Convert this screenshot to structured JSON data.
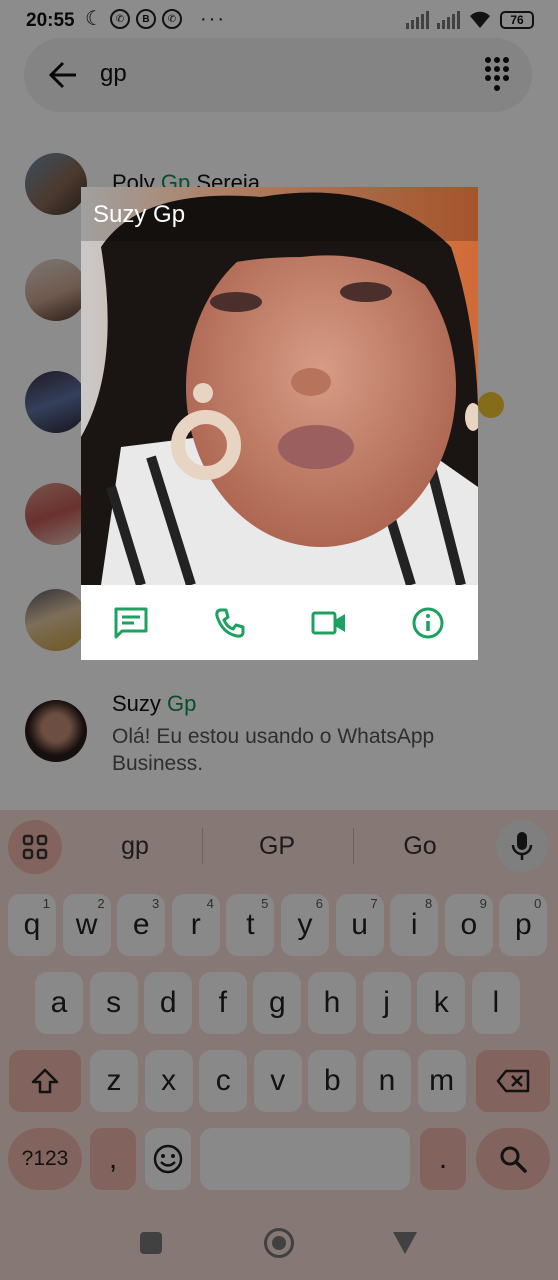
{
  "status_bar": {
    "time": "20:55",
    "notification_icons": [
      "moon-icon",
      "whatsapp-icon",
      "whatsapp-business-icon",
      "whatsapp-icon"
    ],
    "more": "···",
    "battery": "76"
  },
  "search": {
    "query": "gp"
  },
  "results": [
    {
      "name_prefix": "Poly ",
      "name_match": "Gp",
      "name_suffix": " Sereia"
    },
    {
      "name_prefix": "Suzy ",
      "name_match": "Gp",
      "name_suffix": "",
      "subtitle": "Olá! Eu estou usando o WhatsApp Business."
    }
  ],
  "popup": {
    "contact_name": "Suzy Gp",
    "actions": [
      "message-icon",
      "phone-icon",
      "video-call-icon",
      "info-icon"
    ]
  },
  "keyboard": {
    "suggestions": [
      "gp",
      "GP",
      "Go"
    ],
    "row1": [
      {
        "k": "q",
        "n": "1"
      },
      {
        "k": "w",
        "n": "2"
      },
      {
        "k": "e",
        "n": "3"
      },
      {
        "k": "r",
        "n": "4"
      },
      {
        "k": "t",
        "n": "5"
      },
      {
        "k": "y",
        "n": "6"
      },
      {
        "k": "u",
        "n": "7"
      },
      {
        "k": "i",
        "n": "8"
      },
      {
        "k": "o",
        "n": "9"
      },
      {
        "k": "p",
        "n": "0"
      }
    ],
    "row2": [
      "a",
      "s",
      "d",
      "f",
      "g",
      "h",
      "j",
      "k",
      "l"
    ],
    "row3": [
      "z",
      "x",
      "c",
      "v",
      "b",
      "n",
      "m"
    ],
    "symbols_key": "?123",
    "comma_key": ",",
    "period_key": "."
  },
  "colors": {
    "whatsapp_green": "#128c4e",
    "keyboard_bg": "#f2dad6",
    "keyboard_accent": "#efb5ab"
  }
}
